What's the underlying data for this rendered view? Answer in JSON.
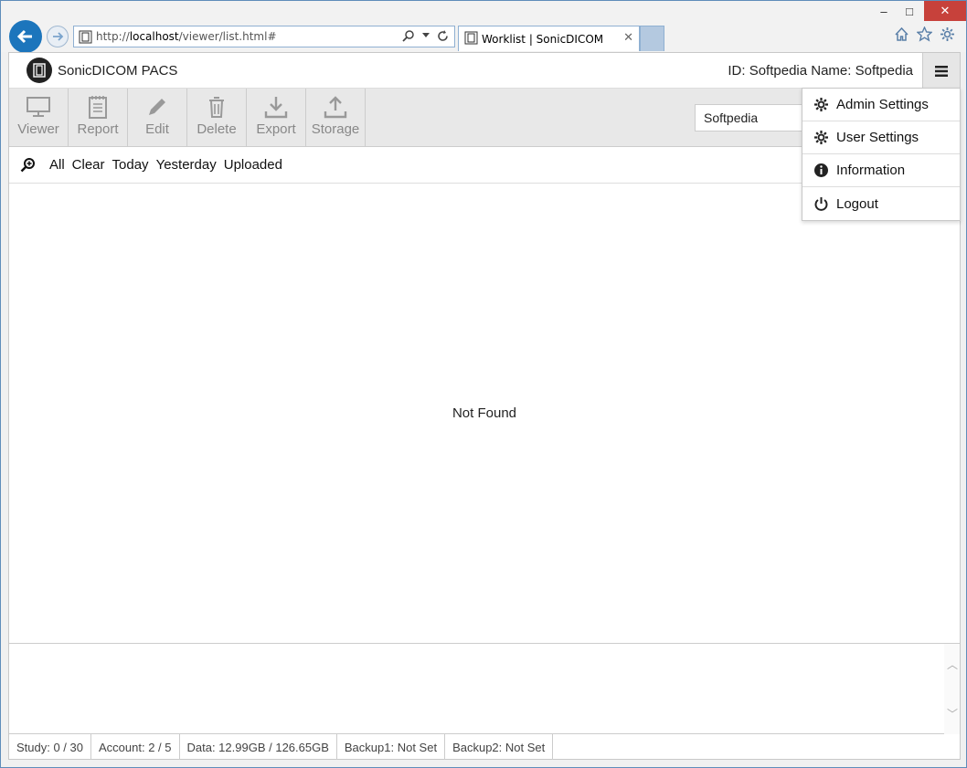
{
  "browser": {
    "url_prefix": "http://",
    "url_host": "localhost",
    "url_path": "/viewer/list.html#",
    "tab_title": "Worklist | SonicDICOM",
    "tab_close": "✕",
    "min": "–",
    "max": "□",
    "close": "✕"
  },
  "app": {
    "name": "SonicDICOM PACS",
    "user_info": "ID: Softpedia  Name: Softpedia"
  },
  "toolbar": {
    "items": [
      {
        "label": "Viewer",
        "icon": "monitor-icon"
      },
      {
        "label": "Report",
        "icon": "notepad-icon"
      },
      {
        "label": "Edit",
        "icon": "pencil-icon"
      },
      {
        "label": "Delete",
        "icon": "trash-icon"
      },
      {
        "label": "Export",
        "icon": "download-icon"
      },
      {
        "label": "Storage",
        "icon": "upload-icon"
      }
    ],
    "search_value": "Softpedia"
  },
  "filters": [
    "All",
    "Clear",
    "Today",
    "Yesterday",
    "Uploaded"
  ],
  "main": {
    "empty_message": "Not Found"
  },
  "menu": [
    {
      "label": "Admin Settings",
      "icon": "gear-icon"
    },
    {
      "label": "User Settings",
      "icon": "gear-icon"
    },
    {
      "label": "Information",
      "icon": "info-icon"
    },
    {
      "label": "Logout",
      "icon": "power-icon"
    }
  ],
  "status": [
    "Study: 0 / 30",
    "Account: 2 / 5",
    "Data: 12.99GB / 126.65GB",
    "Backup1: Not Set",
    "Backup2: Not Set"
  ],
  "colors": {
    "accent": "#1c75bc",
    "toolbar_bg": "#e8e8e8",
    "close_red": "#c7413b"
  }
}
